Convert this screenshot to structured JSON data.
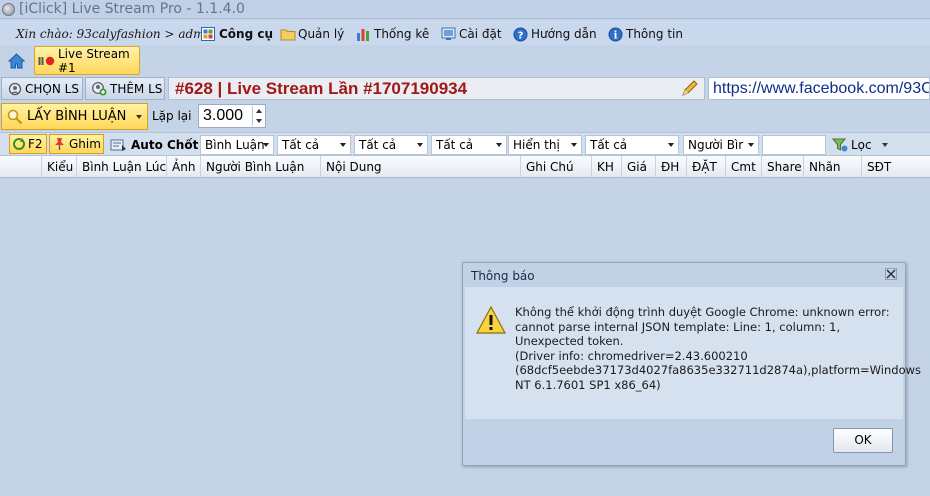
{
  "window": {
    "title": "[iClick] Live Stream Pro - 1.1.4.0"
  },
  "menubar": {
    "greeting": "Xin chào: 93calyfashion > admin",
    "items": [
      {
        "label": "Công cụ",
        "icon": "tools-grid-icon",
        "bold": true
      },
      {
        "label": "Quản lý",
        "icon": "folder-icon"
      },
      {
        "label": "Thống kê",
        "icon": "bar-chart-icon"
      },
      {
        "label": "Cài đặt",
        "icon": "settings-icon"
      },
      {
        "label": "Hướng dẫn",
        "icon": "help-icon"
      },
      {
        "label": "Thông tin",
        "icon": "info-icon"
      }
    ]
  },
  "tabs": {
    "active": "Live Stream #1"
  },
  "stream": {
    "choose_label": "CHỌN LS",
    "add_label": "THÊM LS",
    "title": "#628 | Live Stream Lần #1707190934",
    "url": "https://www.facebook.com/93C..."
  },
  "controls": {
    "get_comments_label": "LẤY BÌNH LUẬN",
    "repeat_label": "Lặp lại",
    "repeat_value": "3.000"
  },
  "filterbar": {
    "f2_label": "F2",
    "pin_label": "Ghim",
    "auto_label": "Auto Chốt",
    "filters": [
      "Bình Luận",
      "Tất cả",
      "Tất cả",
      "Tất cả",
      "Hiển thị",
      "Tất cả",
      "Người Bìr"
    ],
    "filter_label": "Lọc"
  },
  "grid": {
    "columns": [
      "Kiểu",
      "Bình Luận Lúc",
      "Ảnh",
      "Người Bình Luận",
      "Nội Dung",
      "Ghi Chú",
      "KH",
      "Giá",
      "ĐH",
      "ĐẶT",
      "Cmt",
      "Share",
      "Nhãn",
      "SĐT"
    ]
  },
  "dialog": {
    "title": "Thông báo",
    "message": "Không thể khởi động trình duyệt Google Chrome: unknown error: cannot parse internal JSON template: Line: 1, column: 1, Unexpected token.\n  (Driver info: chromedriver=2.43.600210 (68dcf5eebde37173d4027fa8635e332711d2874a),platform=Windows NT 6.1.7601 SP1 x86_64)",
    "ok_label": "OK"
  },
  "colors": {
    "accent_yellow": "#ffd75a",
    "title_red": "#a01818",
    "url_blue": "#0d2f8c",
    "panel": "#c4d3e6"
  }
}
